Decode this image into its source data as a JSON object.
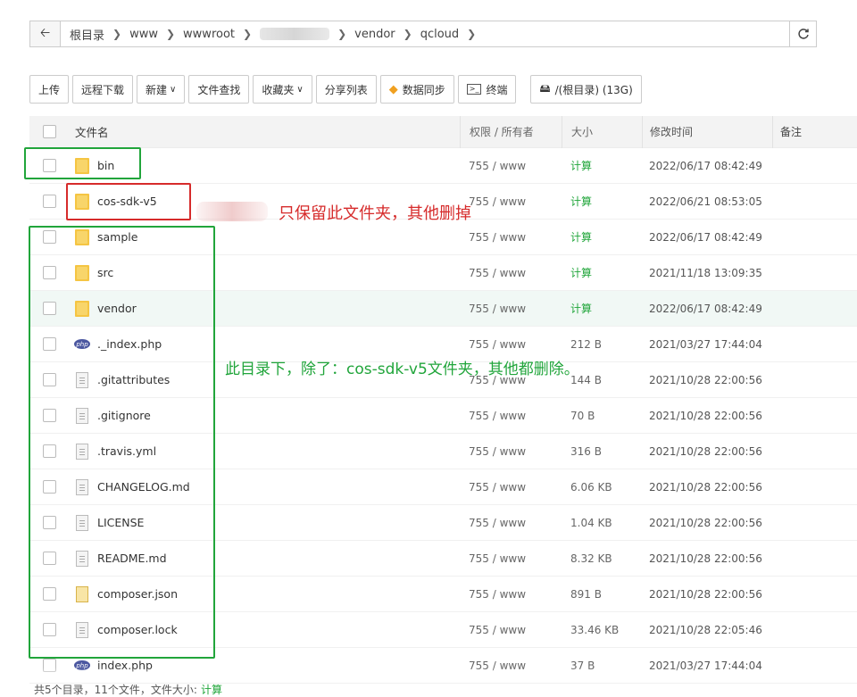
{
  "breadcrumb": {
    "back_icon": "arrow-left",
    "items": [
      "根目录",
      "www",
      "wwwroot",
      "vendor",
      "qcloud"
    ],
    "refresh_icon": "refresh"
  },
  "toolbar": {
    "upload": "上传",
    "remote_download": "远程下载",
    "new": "新建",
    "file_search": "文件查找",
    "favorites": "收藏夹",
    "share_list": "分享列表",
    "data_sync": "数据同步",
    "terminal": "终端",
    "disk": "/(根目录) (13G)"
  },
  "table": {
    "headers": {
      "name": "文件名",
      "perm": "权限 / 所有者",
      "size": "大小",
      "mtime": "修改时间",
      "note": "备注"
    },
    "rows": [
      {
        "name": "bin",
        "type": "folder",
        "perm": "755 / www",
        "size": "计算",
        "mtime": "2022/06/17 08:42:49"
      },
      {
        "name": "cos-sdk-v5",
        "type": "folder",
        "perm": "755 / www",
        "size": "计算",
        "mtime": "2022/06/21 08:53:05"
      },
      {
        "name": "sample",
        "type": "folder",
        "perm": "755 / www",
        "size": "计算",
        "mtime": "2022/06/17 08:42:49"
      },
      {
        "name": "src",
        "type": "folder",
        "perm": "755 / www",
        "size": "计算",
        "mtime": "2021/11/18 13:09:35"
      },
      {
        "name": "vendor",
        "type": "folder",
        "perm": "755 / www",
        "size": "计算",
        "mtime": "2022/06/17 08:42:49"
      },
      {
        "name": "._index.php",
        "type": "php",
        "perm": "755 / www",
        "size": "212 B",
        "mtime": "2021/03/27 17:44:04"
      },
      {
        "name": ".gitattributes",
        "type": "file",
        "perm": "755 / www",
        "size": "144 B",
        "mtime": "2021/10/28 22:00:56"
      },
      {
        "name": ".gitignore",
        "type": "file",
        "perm": "755 / www",
        "size": "70 B",
        "mtime": "2021/10/28 22:00:56"
      },
      {
        "name": ".travis.yml",
        "type": "file",
        "perm": "755 / www",
        "size": "316 B",
        "mtime": "2021/10/28 22:00:56"
      },
      {
        "name": "CHANGELOG.md",
        "type": "file",
        "perm": "755 / www",
        "size": "6.06 KB",
        "mtime": "2021/10/28 22:00:56"
      },
      {
        "name": "LICENSE",
        "type": "file",
        "perm": "755 / www",
        "size": "1.04 KB",
        "mtime": "2021/10/28 22:00:56"
      },
      {
        "name": "README.md",
        "type": "file",
        "perm": "755 / www",
        "size": "8.32 KB",
        "mtime": "2021/10/28 22:00:56"
      },
      {
        "name": "composer.json",
        "type": "json",
        "perm": "755 / www",
        "size": "891 B",
        "mtime": "2021/10/28 22:00:56"
      },
      {
        "name": "composer.lock",
        "type": "file",
        "perm": "755 / www",
        "size": "33.46 KB",
        "mtime": "2021/10/28 22:05:46"
      },
      {
        "name": "index.php",
        "type": "php",
        "perm": "755 / www",
        "size": "37 B",
        "mtime": "2021/03/27 17:44:04"
      }
    ]
  },
  "annotations": {
    "keep_note": "只保留此文件夹，其他删掉",
    "delete_note": "此目录下，除了：cos-sdk-v5文件夹，其他都删除。",
    "red_color": "#d62b2b",
    "green_color": "#21a53b"
  },
  "footer": {
    "summary": "共5个目录，11个文件，文件大小:",
    "calc": "计算"
  }
}
